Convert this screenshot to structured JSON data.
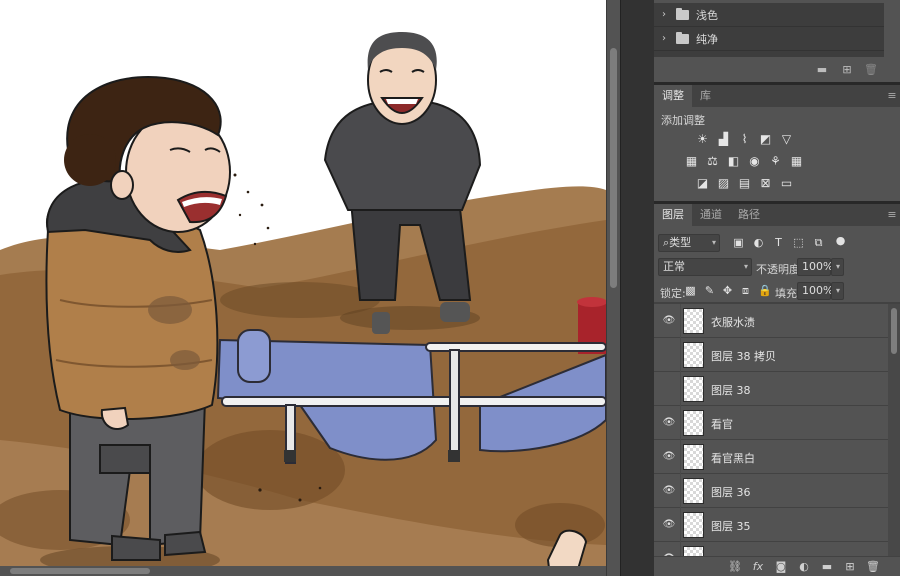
{
  "libraries": {
    "folders": [
      {
        "label": "浅色",
        "collapsed": true
      },
      {
        "label": "纯净",
        "collapsed": true
      }
    ]
  },
  "adjustments_panel": {
    "tabs": [
      {
        "label": "调整",
        "active": true
      },
      {
        "label": "库",
        "active": false
      }
    ],
    "title": "添加调整",
    "icons_row1": [
      "brightness-icon",
      "levels-icon",
      "curves-icon",
      "exposure-icon",
      "vibrance-icon"
    ],
    "icons_row2": [
      "hue-saturation-icon",
      "color-balance-icon",
      "black-white-icon",
      "photo-filter-icon",
      "channel-mixer-icon",
      "color-lookup-icon"
    ],
    "icons_row3": [
      "invert-icon",
      "posterize-icon",
      "threshold-icon",
      "selective-color-icon",
      "gradient-map-icon"
    ]
  },
  "layers_panel": {
    "tabs": [
      {
        "label": "图层",
        "active": true
      },
      {
        "label": "通道",
        "active": false
      },
      {
        "label": "路径",
        "active": false
      }
    ],
    "filter_kind": "类型",
    "blend_mode": "正常",
    "opacity_label": "不透明度:",
    "opacity_value": "100%",
    "lock_label": "锁定:",
    "fill_label": "填充:",
    "fill_value": "100%",
    "layers": [
      {
        "name": "衣服水渍",
        "visible": true
      },
      {
        "name": "图层 38 拷贝",
        "visible": false
      },
      {
        "name": "图层 38",
        "visible": false
      },
      {
        "name": "看官",
        "visible": true
      },
      {
        "name": "看官黑白",
        "visible": true
      },
      {
        "name": "图层 36",
        "visible": true
      },
      {
        "name": "图层 35",
        "visible": true
      }
    ],
    "bottom_icons": [
      "link-icon",
      "fx-icon",
      "mask-icon",
      "adjustment-icon",
      "group-icon",
      "new-layer-icon",
      "trash-icon"
    ]
  },
  "colors": {
    "panel_bg": "#535353",
    "dark_bg": "#282828",
    "tab_bar": "#424242",
    "jacket_tan": "#b07f4a",
    "mud_brown": "#8c6033",
    "stretcher_blue": "#7f8fc9"
  }
}
